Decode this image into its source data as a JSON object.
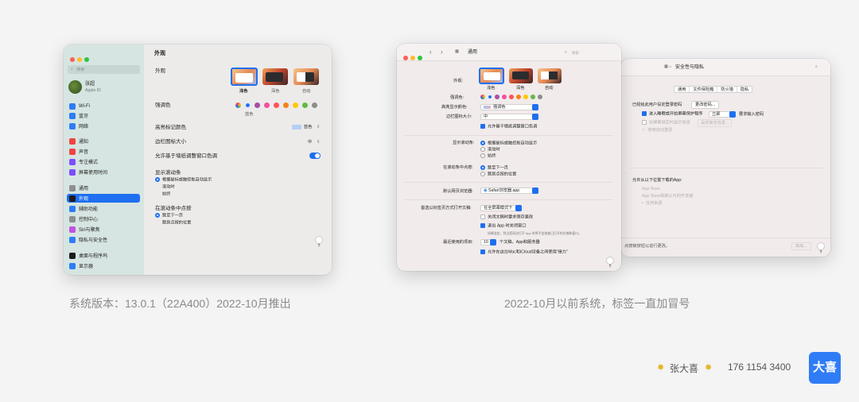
{
  "left": {
    "search_placeholder": "搜索",
    "user_name": "张超",
    "user_sub": "Apple ID",
    "title": "外观",
    "sidebar": [
      "Wi-Fi",
      "蓝牙",
      "网络",
      "通知",
      "声音",
      "专注模式",
      "屏幕使用时间",
      "通用",
      "外观",
      "辅助功能",
      "控制中心",
      "Siri与聚焦",
      "隐私与安全性",
      "桌面与程序坞",
      "显示器"
    ],
    "appearance_label": "外观",
    "themes": [
      "浅色",
      "深色",
      "自动"
    ],
    "accent_label": "强调色",
    "accent_value": "蓝色",
    "highlight_label": "高亮标记颜色",
    "highlight_value": "蓝色",
    "icon_size_label": "边栏图标大小",
    "icon_size_value": "中",
    "wallpaper_tint_label": "允许基于墙纸调整窗口色调",
    "scrollbar_label": "显示滚动条",
    "scrollbar_opts": [
      "根据鼠标或触控板自动显示",
      "滚动时",
      "始终"
    ],
    "click_label": "在滚动条中点按",
    "click_opts": [
      "跳至下一页",
      "跳到点按的位置"
    ],
    "help": "?"
  },
  "mid": {
    "title": "通用",
    "search": "搜索",
    "appearance_label": "外观:",
    "themes": [
      "浅色",
      "深色",
      "自动"
    ],
    "accent_label": "强调色:",
    "highlight_label": "高亮显示颜色:",
    "highlight_value": "强调色",
    "icon_size_label": "边栏图标大小:",
    "icon_size_value": "中",
    "wallpaper_tint": "允许基于墙纸调整窗口色调",
    "scrollbar_label": "显示滚动条:",
    "scrollbar_opts": [
      "根据鼠标或触控板自动显示",
      "滚动时",
      "始终"
    ],
    "click_label": "在滚动条中点按:",
    "click_opts": [
      "跳至下一页",
      "跳到点按的位置"
    ],
    "browser_label": "默认网页浏览器:",
    "browser_value": "Safari浏览器.app",
    "tabs_label": "首选以标签页方式打开文稿:",
    "tabs_value": "在全屏幕模式下",
    "ask_save": "关闭文稿时要求保存更改",
    "close_windows": "退出 App 时关闭窗口",
    "close_windows_note": "如果选定，则当您再次打开 App 时将不会恢复已打开的文稿和窗口。",
    "recent_label": "最近使用的项目:",
    "recent_value": "10",
    "recent_suffix": "个文稿、App和服务器",
    "handoff": "允许在这台Mac和iCloud设备之间使用“接力”",
    "help": "?"
  },
  "right": {
    "title": "安全性与隐私",
    "tabs": [
      "通用",
      "文件保险箱",
      "防火墙",
      "隐私"
    ],
    "login_pw": "已经给此用户设定登录密码",
    "change_pw": "更改密码...",
    "require_pw": "进入睡眠或开始屏幕保护程序",
    "require_value": "立即",
    "require_suffix": "要求输入密码",
    "show_msg": "在屏幕锁定时显示信息",
    "set_lock": "设定锁定信息...",
    "disable_login": "停用自动登录",
    "allow_from": "允许从以下位置下载的App:",
    "allow_opts": [
      "App Store",
      "App Store和被认可的开发者",
      "任何来源"
    ],
    "lock_text": "点按锁按钮以进行更改。",
    "advanced": "高级...",
    "help": "?"
  },
  "captions": {
    "left": "系统版本：13.0.1（22A400）2022-10月推出",
    "right": "2022-10月以前系统，标签一直加冒号"
  },
  "footer": {
    "name": "张大喜",
    "phone": "176 1154 3400",
    "logo": "大喜"
  },
  "colors": {
    "accent": "#1f6ff0",
    "sidebar_bg": "#d5e6e2",
    "brand": "#2f7cf6"
  }
}
